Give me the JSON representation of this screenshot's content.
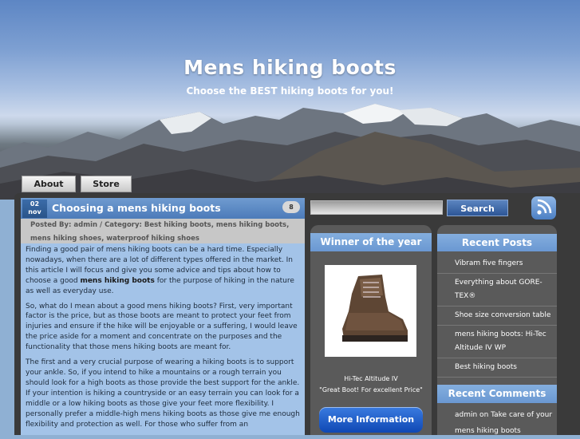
{
  "header": {
    "title": "Mens hiking boots",
    "subtitle": "Choose the BEST hiking boots for you!"
  },
  "nav": {
    "items": [
      "About",
      "Store"
    ]
  },
  "post": {
    "date_day": "02",
    "date_month": "nov",
    "title": "Choosing a mens hiking boots",
    "comment_count": "8",
    "meta_prefix": "Posted By: ",
    "meta_author": "admin",
    "meta_mid": " / Category: ",
    "meta_categories_line1": "Best hiking boots, mens hiking boots,",
    "meta_categories_line2": "mens hiking shoes, waterproof hiking shoes",
    "p1_a": "Finding a good pair of mens hiking boots can be a hard time. Especially nowadays, when  there are a lot of different types offered in the market. In this article I will focus and give you some advice and tips about how to choose a good ",
    "p1_bold": "mens hiking boots",
    "p1_b": " for the purpose of hiking in the nature as well as everyday use.",
    "p2": "So, what do I mean about a good mens hiking boots? First, very important factor is the price, but as those boots are meant to protect your feet from injuries and ensure if the hike will be enjoyable or a suffering, I would leave the price aside for a moment and concentrate on the purposes and the functionality that those mens hiking boots are meant for.",
    "p3": "The first and a very crucial purpose of wearing a hiking boots is to support your ankle. So, if you intend to hike a mountains or a rough terrain you should look for a high boots as those provide the best support for the ankle. If your intention is hiking a countryside or an easy terrain you can look for a middle or a low hiking boots as those give your feet more flexibility. I personally prefer a middle-high mens hiking boots as those give me enough flexibility and protection as well. For those who suffer from an"
  },
  "search": {
    "button_label": "Search",
    "placeholder": ""
  },
  "winner": {
    "title": "Winner of the year",
    "product_name": "Hi-Tec Altitude IV",
    "quote": "\"Great Boot! For excellent Price\"",
    "button_label": "More Information"
  },
  "recent_posts": {
    "title": "Recent Posts",
    "items": [
      "Vibram five fingers",
      "Everything about GORE-TEX®",
      "Shoe size conversion table",
      "mens hiking boots: Hi-Tec Altitude IV WP",
      "Best hiking boots"
    ]
  },
  "recent_comments": {
    "title": "Recent Comments",
    "text": "admin on Take care of your mens hiking boots"
  },
  "colors": {
    "accent": "#6a98d2",
    "dark_panel": "#5a5a5a",
    "content_bg": "#a3c3e8"
  },
  "icons": {
    "rss": "rss-icon",
    "comment": "comment-bubble-icon"
  }
}
